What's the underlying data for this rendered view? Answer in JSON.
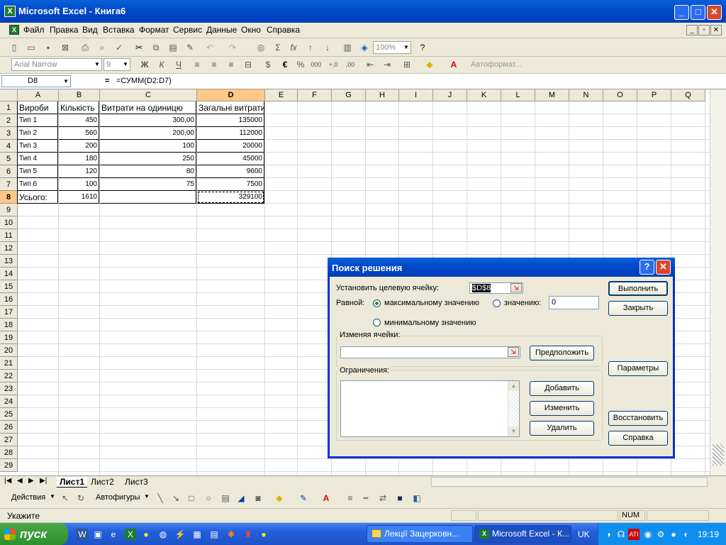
{
  "window": {
    "title": "Microsoft Excel - Книга6"
  },
  "menu": [
    "Файл",
    "Правка",
    "Вид",
    "Вставка",
    "Формат",
    "Сервис",
    "Данные",
    "Окно",
    "Справка"
  ],
  "toolbar": {
    "zoom": "100%",
    "font": "Arial Narrow",
    "size": "9",
    "autoformat": "Автоформат..."
  },
  "formula_bar": {
    "name_box": "D8",
    "fx": "=",
    "formula": "=СУММ(D2:D7)"
  },
  "columns": [
    "A",
    "B",
    "C",
    "D",
    "E",
    "F",
    "G",
    "H",
    "I",
    "J",
    "K",
    "L",
    "M",
    "N",
    "O",
    "P",
    "Q"
  ],
  "rows": [
    "1",
    "2",
    "3",
    "4",
    "5",
    "6",
    "7",
    "8",
    "9",
    "10",
    "11",
    "12",
    "13",
    "14",
    "15",
    "16",
    "17",
    "18",
    "19",
    "20",
    "21",
    "22",
    "23",
    "24",
    "25",
    "26",
    "27",
    "28",
    "29"
  ],
  "table": {
    "headers": [
      "Вироби",
      "Кількість",
      "Витрати на одиницю",
      "Загальні витрати"
    ],
    "rows": [
      [
        "Тип 1",
        "450",
        "300,00",
        "135000"
      ],
      [
        "Тип 2",
        "560",
        "200,00",
        "112000"
      ],
      [
        "Тип 3",
        "200",
        "100",
        "20000"
      ],
      [
        "Тип 4",
        "180",
        "250",
        "45000"
      ],
      [
        "Тип 5",
        "120",
        "80",
        "9600"
      ],
      [
        "Тип 6",
        "100",
        "75",
        "7500"
      ]
    ],
    "total": [
      "Усього:",
      "1610",
      "",
      "329100"
    ]
  },
  "sheet_tabs": [
    "Лист1",
    "Лист2",
    "Лист3"
  ],
  "draw_toolbar": {
    "actions": "Действия",
    "autoshapes": "Автофигуры"
  },
  "status": {
    "left": "Укажите",
    "num": "NUM"
  },
  "dialog": {
    "title": "Поиск решения",
    "target_label": "Установить целевую ячейку:",
    "target_value": "$D$8",
    "equal_label": "Равной:",
    "opt_max": "максимальному значению",
    "opt_value": "значению:",
    "value_input": "0",
    "opt_min": "минимальному значению",
    "changing_label": "Изменяя ячейки:",
    "changing_value": "",
    "constraints_label": "Ограничения:",
    "btn_run": "Выполнить",
    "btn_close": "Закрыть",
    "btn_guess": "Предположить",
    "btn_params": "Параметры",
    "btn_add": "Добавить",
    "btn_change": "Изменить",
    "btn_delete": "Удалить",
    "btn_restore": "Восстановить",
    "btn_help": "Справка"
  },
  "taskbar": {
    "start": "пуск",
    "tasks": [
      "Лекції Зацерковн...",
      "Microsoft Excel - К..."
    ],
    "lang": "UK",
    "clock": "19:19"
  }
}
